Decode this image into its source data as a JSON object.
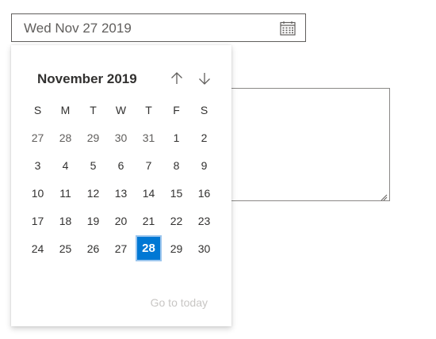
{
  "date_field": {
    "value": "Wed Nov 27 2019",
    "icon": "calendar-icon"
  },
  "calendar": {
    "month_title": "November 2019",
    "nav_up_icon": "arrow-up-icon",
    "nav_down_icon": "arrow-down-icon",
    "weekdays": [
      "S",
      "M",
      "T",
      "W",
      "T",
      "F",
      "S"
    ],
    "weeks": [
      [
        {
          "d": "27",
          "o": true
        },
        {
          "d": "28",
          "o": true
        },
        {
          "d": "29",
          "o": true
        },
        {
          "d": "30",
          "o": true
        },
        {
          "d": "31",
          "o": true
        },
        {
          "d": "1"
        },
        {
          "d": "2"
        }
      ],
      [
        {
          "d": "3"
        },
        {
          "d": "4"
        },
        {
          "d": "5"
        },
        {
          "d": "6"
        },
        {
          "d": "7"
        },
        {
          "d": "8"
        },
        {
          "d": "9"
        }
      ],
      [
        {
          "d": "10"
        },
        {
          "d": "11"
        },
        {
          "d": "12"
        },
        {
          "d": "13"
        },
        {
          "d": "14"
        },
        {
          "d": "15"
        },
        {
          "d": "16"
        }
      ],
      [
        {
          "d": "17"
        },
        {
          "d": "18"
        },
        {
          "d": "19"
        },
        {
          "d": "20"
        },
        {
          "d": "21"
        },
        {
          "d": "22"
        },
        {
          "d": "23"
        }
      ],
      [
        {
          "d": "24"
        },
        {
          "d": "25"
        },
        {
          "d": "26"
        },
        {
          "d": "27"
        },
        {
          "d": "28",
          "selected": true
        },
        {
          "d": "29"
        },
        {
          "d": "30"
        }
      ]
    ],
    "go_to_today": "Go to today"
  },
  "colors": {
    "accent": "#0078d4",
    "text": "#323130",
    "muted": "#605e5c",
    "disabled": "#c8c6c4"
  }
}
